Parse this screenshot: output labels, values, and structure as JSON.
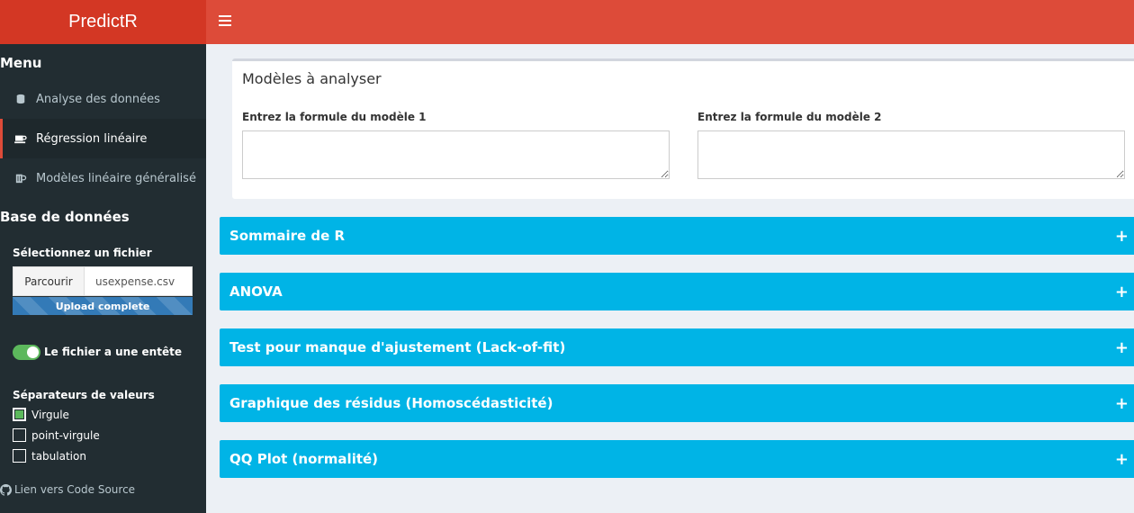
{
  "app": {
    "title": "PredictR"
  },
  "sidebar": {
    "menu_heading": "Menu",
    "items": [
      {
        "label": "Analyse des données",
        "icon": "database-icon"
      },
      {
        "label": "Régression linéaire",
        "icon": "coffee-icon",
        "active": true
      },
      {
        "label": "Modèles linéaire généralisé",
        "icon": "beer-icon"
      }
    ],
    "db_heading": "Base de données",
    "file_label": "Sélectionnez un fichier",
    "browse_label": "Parcourir",
    "file_name": "usexpense.csv",
    "upload_status": "Upload complete",
    "header_toggle_label": "Le fichier a une entête",
    "separators_label": "Séparateurs de valeurs",
    "separators": [
      {
        "label": "Virgule",
        "checked": true
      },
      {
        "label": "point-virgule",
        "checked": false
      },
      {
        "label": "tabulation",
        "checked": false
      }
    ],
    "source_link": "Lien vers Code Source"
  },
  "main": {
    "models_box_title": "Modèles à analyser",
    "model1_label": "Entrez la formule du modèle 1",
    "model2_label": "Entrez la formule du modèle 2",
    "accordions": [
      "Sommaire de R",
      "ANOVA",
      "Test pour manque d'ajustement (Lack-of-fit)",
      "Graphique des résidus (Homoscédasticité)",
      "QQ Plot (normalité)"
    ]
  },
  "colors": {
    "header": "#dd4b39",
    "logo": "#d33724",
    "sidebar": "#222d32",
    "accordion": "#00b4e6",
    "toggle": "#5cb85c"
  }
}
